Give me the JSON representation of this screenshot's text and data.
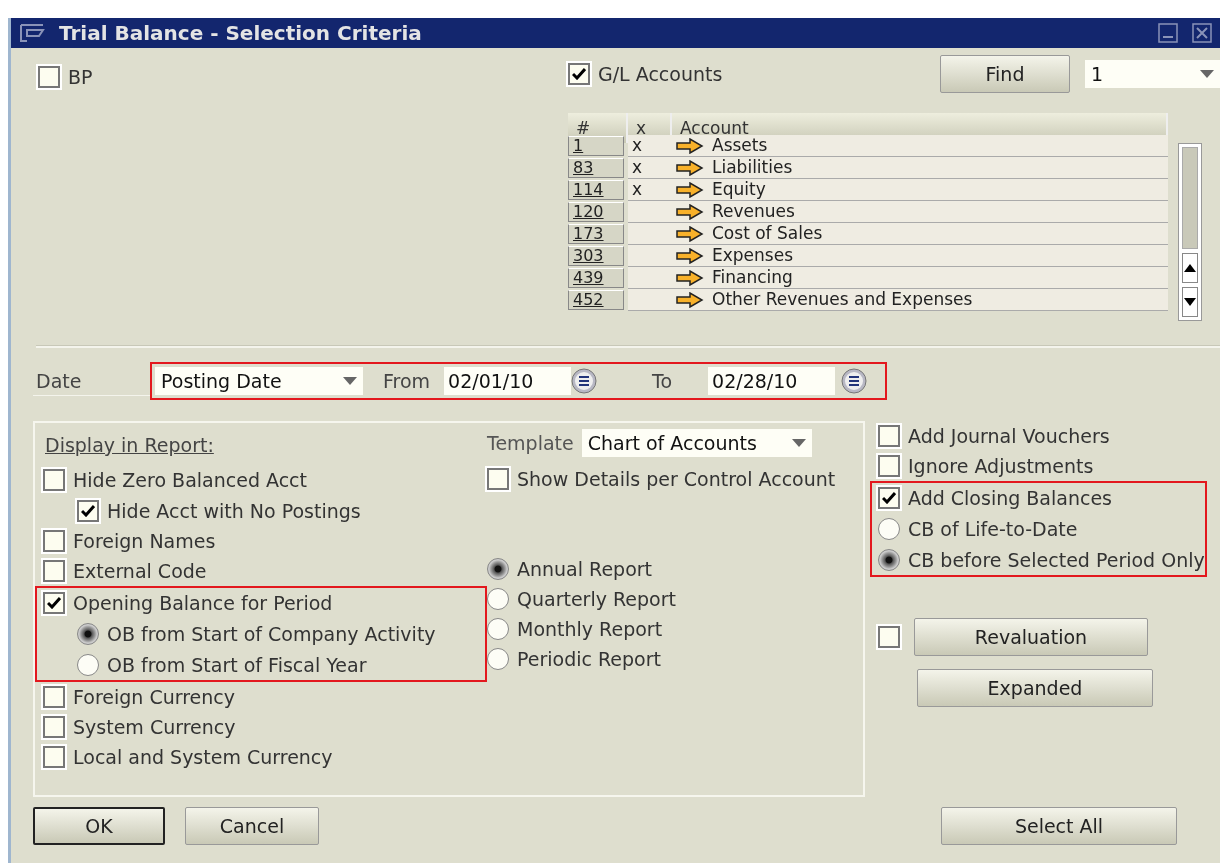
{
  "window": {
    "title": "Trial Balance - Selection Criteria"
  },
  "bp": {
    "label": "BP",
    "checked": false
  },
  "gl_accounts": {
    "label": "G/L Accounts",
    "checked": true
  },
  "find_button": {
    "label": "Find"
  },
  "find_dropdown": {
    "value": "1"
  },
  "accounts_table": {
    "columns": [
      "#",
      "x",
      "Account"
    ],
    "rows": [
      {
        "number": "1",
        "mark": "x",
        "account": "Assets"
      },
      {
        "number": "83",
        "mark": "x",
        "account": "Liabilities"
      },
      {
        "number": "114",
        "mark": "x",
        "account": "Equity"
      },
      {
        "number": "120",
        "account": "Revenues"
      },
      {
        "number": "173",
        "account": "Cost of Sales"
      },
      {
        "number": "303",
        "account": "Expenses"
      },
      {
        "number": "439",
        "account": "Financing"
      },
      {
        "number": "452",
        "account": "Other Revenues and Expenses"
      }
    ]
  },
  "date": {
    "label": "Date",
    "highlighted": true,
    "type": "Posting Date",
    "from_label": "From",
    "from": "02/01/10",
    "to_label": "To",
    "to": "02/28/10"
  },
  "display": {
    "title": "Display in Report:",
    "options": [
      {
        "kind": "checkbox",
        "label": "Hide Zero Balanced Acct",
        "checked": false,
        "children": [
          {
            "kind": "checkbox",
            "label": "Hide Acct with No Postings",
            "checked": true
          }
        ]
      },
      {
        "kind": "checkbox",
        "label": "Foreign Names",
        "checked": false
      },
      {
        "kind": "checkbox",
        "label": "External Code",
        "checked": false
      },
      {
        "kind": "checkbox",
        "label": "Opening Balance for Period",
        "checked": true,
        "highlighted": true,
        "children": [
          {
            "kind": "radio",
            "label": "OB from Start of Company Activity",
            "selected": true
          },
          {
            "kind": "radio",
            "label": "OB from Start of Fiscal Year",
            "selected": false
          }
        ]
      },
      {
        "kind": "checkbox",
        "label": "Foreign Currency",
        "checked": false
      },
      {
        "kind": "checkbox",
        "label": "System Currency",
        "checked": false
      },
      {
        "kind": "checkbox",
        "label": "Local and System Currency",
        "checked": false
      }
    ]
  },
  "template": {
    "label": "Template",
    "value": "Chart of Accounts"
  },
  "show_details": {
    "label": "Show Details per Control Account",
    "checked": false
  },
  "report_types": [
    {
      "label": "Annual Report",
      "selected": true
    },
    {
      "label": "Quarterly Report",
      "selected": false
    },
    {
      "label": "Monthly Report",
      "selected": false
    },
    {
      "label": "Periodic Report",
      "selected": false
    }
  ],
  "right_options": [
    {
      "kind": "checkbox",
      "label": "Add Journal Vouchers",
      "checked": false
    },
    {
      "kind": "checkbox",
      "label": "Ignore Adjustments",
      "checked": false
    },
    {
      "kind": "checkbox",
      "label": "Add Closing Balances",
      "checked": true,
      "highlighted": true,
      "children": [
        {
          "kind": "radio",
          "label": "CB of Life-to-Date",
          "selected": false
        },
        {
          "kind": "radio",
          "label": "CB before Selected Period Only",
          "selected": true
        }
      ]
    }
  ],
  "revaluation": {
    "checked": false,
    "label": "Revaluation"
  },
  "expanded_button": {
    "label": "Expanded"
  },
  "buttons": [
    {
      "label": "OK",
      "default": true
    },
    {
      "label": "Cancel",
      "default": false
    }
  ],
  "select_all_button": {
    "label": "Select All"
  }
}
